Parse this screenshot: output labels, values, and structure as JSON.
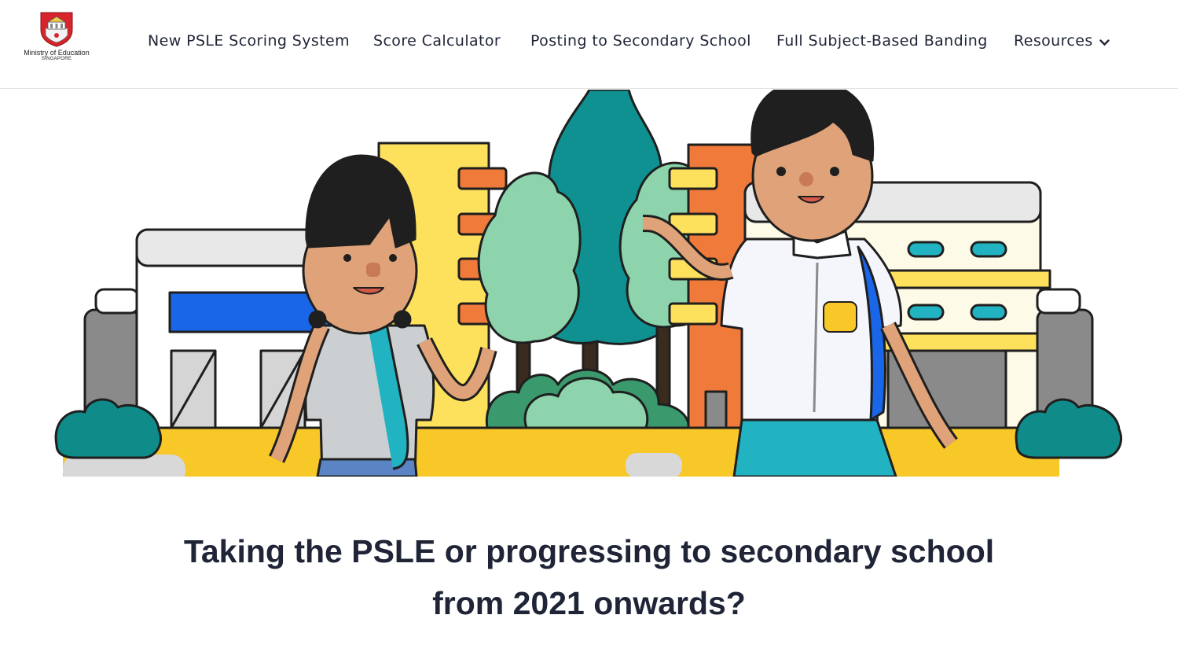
{
  "header": {
    "logo": {
      "line1": "Ministry of Education",
      "line2": "SINGAPORE",
      "icon": "moe-crest-icon"
    },
    "nav": [
      {
        "label": "New PSLE Scoring System"
      },
      {
        "label": "Score Calculator"
      },
      {
        "label": "Posting to Secondary School"
      },
      {
        "label": "Full Subject-Based Banding"
      },
      {
        "label": "Resources",
        "icon": "chevron-down-icon"
      }
    ]
  },
  "hero": {
    "illustration": "students-walking-to-school-illustration",
    "colors": {
      "yellow": "#f8c728",
      "teal": "#0f9191",
      "orange": "#f07a3a",
      "blue": "#1a66e8",
      "green": "#8dd4ac",
      "outline": "#1f1f1f"
    }
  },
  "main": {
    "headline": "Taking the PSLE or progressing to secondary school from 2021 onwards?"
  }
}
